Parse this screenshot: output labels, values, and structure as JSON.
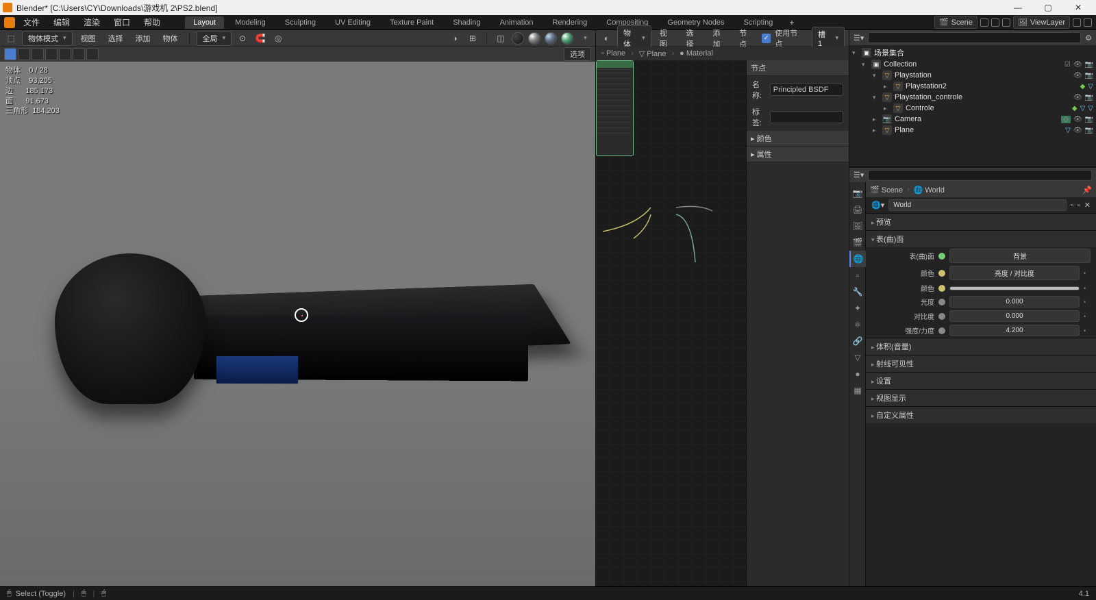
{
  "title": "Blender* [C:\\Users\\CY\\Downloads\\游戏机 2\\PS2.blend]",
  "menu": {
    "file": "文件",
    "edit": "编辑",
    "render": "渲染",
    "window": "窗口",
    "help": "帮助"
  },
  "workspaces": [
    "Layout",
    "Modeling",
    "Sculpting",
    "UV Editing",
    "Texture Paint",
    "Shading",
    "Animation",
    "Rendering",
    "Compositing",
    "Geometry Nodes",
    "Scripting"
  ],
  "scene_field": {
    "label": "Scene"
  },
  "viewlayer_field": {
    "label": "ViewLayer"
  },
  "viewport_hdr": {
    "mode": "物体模式",
    "view": "视图",
    "select": "选择",
    "add": "添加",
    "object": "物体",
    "global": "全局",
    "options": "选项"
  },
  "stats": {
    "objects_lbl": "物体",
    "objects": "0 / 28",
    "verts_lbl": "顶点",
    "verts": "93,205",
    "edges_lbl": "边",
    "edges": "185,173",
    "faces_lbl": "面",
    "faces": "91,673",
    "tris_lbl": "三角形",
    "tris": "184,203"
  },
  "node_hdr": {
    "view": "视图",
    "select": "选择",
    "add": "添加",
    "node": "节点",
    "use_nodes_chk": "使用节点",
    "slot": "槽 1",
    "type": "物体"
  },
  "node_bread": {
    "obj": "Plane",
    "mesh": "Plane",
    "mat": "Material"
  },
  "node_side": {
    "tab": "节点",
    "name_lbl": "名称:",
    "name_val": "Principled BSDF",
    "label_lbl": "标签:",
    "color_panel": "颜色",
    "props_panel": "属性"
  },
  "outliner": {
    "root": "场景集合",
    "coll": "Collection",
    "items": [
      {
        "name": "Playstation",
        "children": [
          "Playstation2"
        ],
        "icons": 2
      },
      {
        "name": "Playstation_controle",
        "children": [
          "Controle"
        ],
        "icons": 3
      },
      {
        "name": "Camera",
        "cam": true
      },
      {
        "name": "Plane"
      }
    ]
  },
  "props": {
    "scene": "Scene",
    "world": "World",
    "world2": "World",
    "preview": "预览",
    "surface": "表(曲)面",
    "surf_lbl": "表(曲)面",
    "surf_val": "背景",
    "color_lbl": "颜色",
    "bc_val": "亮度 / 对比度",
    "col2_lbl": "颜色",
    "bright_lbl": "光度",
    "bright_val": "0.000",
    "contrast_lbl": "对比度",
    "contrast_val": "0.000",
    "strength_lbl": "强度/力度",
    "strength_val": "4.200",
    "volume": "体积(音量)",
    "ray_vis": "射线可见性",
    "settings": "设置",
    "viewport_display": "视图显示",
    "custom": "自定义属性"
  },
  "status": {
    "left": "Select (Toggle)",
    "ver": "4.1"
  }
}
